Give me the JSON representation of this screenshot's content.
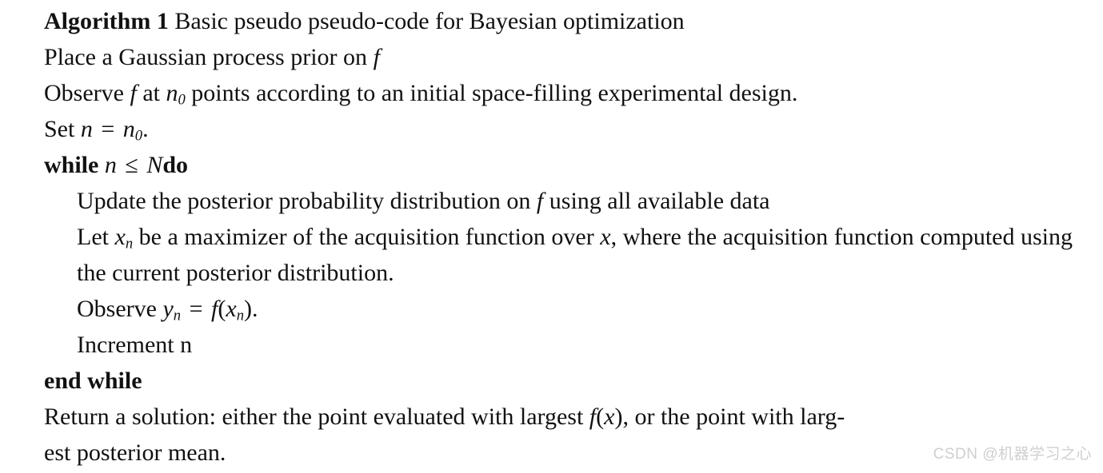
{
  "algorithm": {
    "header": {
      "label": "Algorithm 1",
      "title": "Basic pseudo pseudo-code for Bayesian optimization"
    },
    "lines": [
      {
        "id": "place-prior",
        "indent": false,
        "text_plain": "Place a Gaussian process prior on f",
        "parts": {
          "lead": "Place a Gaussian process prior on",
          "var_f": "f"
        }
      },
      {
        "id": "observe-initial",
        "indent": false,
        "text_plain": "Observe f at n0 points according to an initial space-filling experimental design.",
        "parts": {
          "a": "Observe",
          "var_f": "f",
          "b": "at",
          "var_n": "n",
          "sub_0": "0",
          "c": "points according to an initial space-filling experimental design."
        }
      },
      {
        "id": "set-n",
        "indent": false,
        "text_plain": "Set n = n0.",
        "parts": {
          "a": "Set",
          "var_n": "n",
          "eq": "=",
          "var_n2": "n",
          "sub_0": "0",
          "period": "."
        }
      },
      {
        "id": "while-header",
        "indent": false,
        "text_plain": "while n ≤ Ndo",
        "parts": {
          "kw_while": "while",
          "var_n": "n",
          "leq": "≤",
          "var_N": "N",
          "kw_do": "do"
        }
      },
      {
        "id": "update-posterior",
        "indent": true,
        "text_plain": "Update the posterior probability distribution on f using all available data",
        "parts": {
          "a": "Update the posterior probability distribution on",
          "var_f": "f",
          "b": "using all available data"
        }
      },
      {
        "id": "let-xn-maximizer",
        "indent": true,
        "text_plain": "Let xn be a maximizer of the acquisition function over x, where the acquisition function computed using the current posterior distribution.",
        "parts": {
          "a": "Let",
          "var_x": "x",
          "sub_n": "n",
          "b": "be a maximizer of the acquisition function over",
          "var_x2": "x",
          "comma": ",",
          "c": "where the acquisition function computed using the current posterior distribution."
        }
      },
      {
        "id": "observe-yn",
        "indent": true,
        "text_plain": "Observe yn = f(xn).",
        "parts": {
          "a": "Observe",
          "var_y": "y",
          "sub_n": "n",
          "eq": "=",
          "var_f": "f",
          "paren_open": "(",
          "var_x": "x",
          "sub_n2": "n",
          "paren_close": ")",
          "period": "."
        }
      },
      {
        "id": "increment-n",
        "indent": true,
        "text_plain": "Increment n",
        "parts": {
          "a": "Increment n"
        }
      },
      {
        "id": "end-while",
        "indent": false,
        "text_plain": "end while",
        "parts": {
          "kw": "end while"
        }
      },
      {
        "id": "return-solution",
        "indent": false,
        "text_plain": "Return a solution: either the point evaluated with largest f(x), or the point with largest posterior mean.",
        "parts": {
          "a": "Return a solution: either the point evaluated with largest",
          "var_f": "f",
          "paren_open": "(",
          "var_x": "x",
          "paren_close": ")",
          "comma": ",",
          "b": "or the point with larg-",
          "c": "est posterior mean."
        }
      }
    ]
  },
  "watermark": {
    "text": "CSDN @机器学习之心",
    "color": "#cfcfcf"
  },
  "page": {
    "background": "#ffffff",
    "text_color": "#111111"
  }
}
